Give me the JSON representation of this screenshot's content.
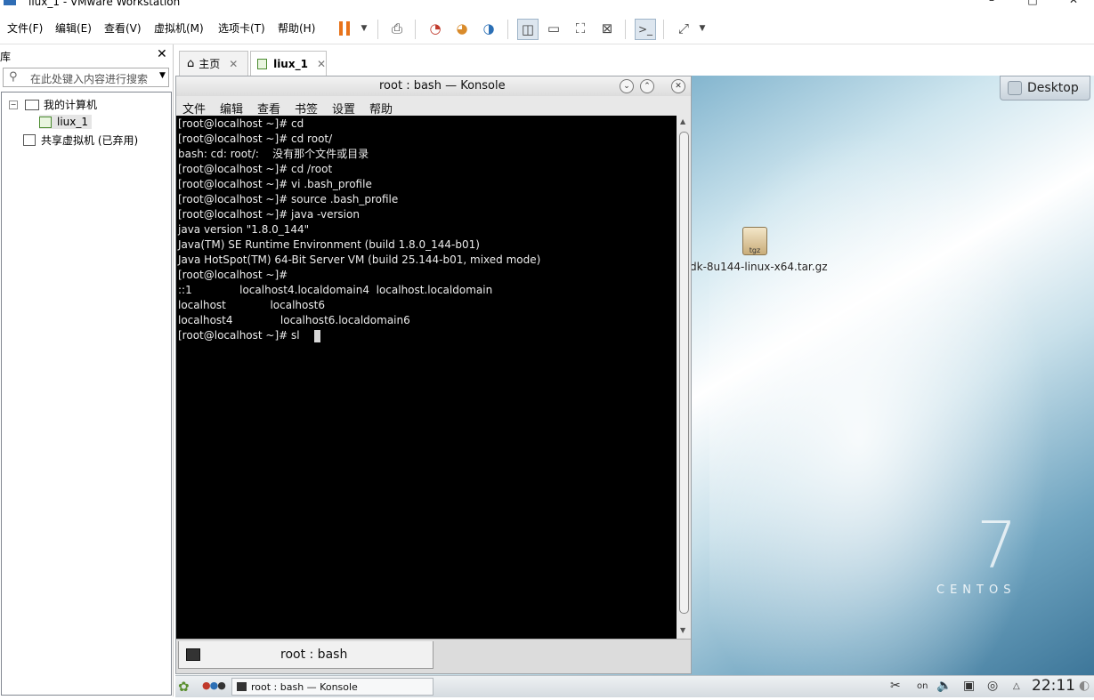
{
  "window": {
    "title": "liux_1 - VMware Workstation",
    "controls": [
      "–",
      "□",
      "✕"
    ]
  },
  "menu": [
    "文件(F)",
    "编辑(E)",
    "查看(V)",
    "虚拟机(M)",
    "选项卡(T)",
    "帮助(H)"
  ],
  "toolbar_icons": [
    "pause-icon",
    "dropdown-icon",
    "send-ctrl-alt-del-icon",
    "snapshot-icon",
    "revert-snapshot-icon",
    "manage-snapshots-icon",
    "library-view-icon",
    "thumbnail-view-icon",
    "fullscreen-icon",
    "unity-icon",
    "console-view-icon",
    "stretch-icon"
  ],
  "library": {
    "title": "库",
    "close": "✕",
    "search_placeholder": "在此处键入内容进行搜索",
    "tree": {
      "root": "我的计算机",
      "vm": "liux_1",
      "shared": "共享虚拟机 (已弃用)"
    }
  },
  "tabs": [
    {
      "label": "主页",
      "icon": "home-icon"
    },
    {
      "label": "liux_1",
      "icon": "vm-icon"
    }
  ],
  "guest": {
    "desktop_button": "Desktop",
    "file_icon_badge": "tgz",
    "file_label": "dk-8u144-linux-x64.tar.gz",
    "os_logo_number": "7",
    "os_logo_word": "CENTOS",
    "konsole": {
      "title": "root : bash — Konsole",
      "menu": [
        "文件",
        "编辑",
        "查看",
        "书签",
        "设置",
        "帮助"
      ],
      "lines": [
        "[root@localhost ~]# cd",
        "[root@localhost ~]# cd root/",
        "bash: cd: root/:    没有那个文件或目录",
        "[root@localhost ~]# cd /root",
        "[root@localhost ~]# vi .bash_profile",
        "[root@localhost ~]# source .bash_profile",
        "[root@localhost ~]# java -version",
        "java version \"1.8.0_144\"",
        "Java(TM) SE Runtime Environment (build 1.8.0_144-b01)",
        "Java HotSpot(TM) 64-Bit Server VM (build 25.144-b01, mixed mode)",
        "[root@localhost ~]#",
        "::1              localhost4.localdomain4  localhost.localdomain",
        "localhost             localhost6",
        "localhost4              localhost6.localdomain6",
        "[root@localhost ~]# sl"
      ],
      "tab_label": "root : bash"
    },
    "taskbar": {
      "task_label": "root : bash — Konsole",
      "clock": "22:11",
      "tray_text": "on"
    }
  }
}
